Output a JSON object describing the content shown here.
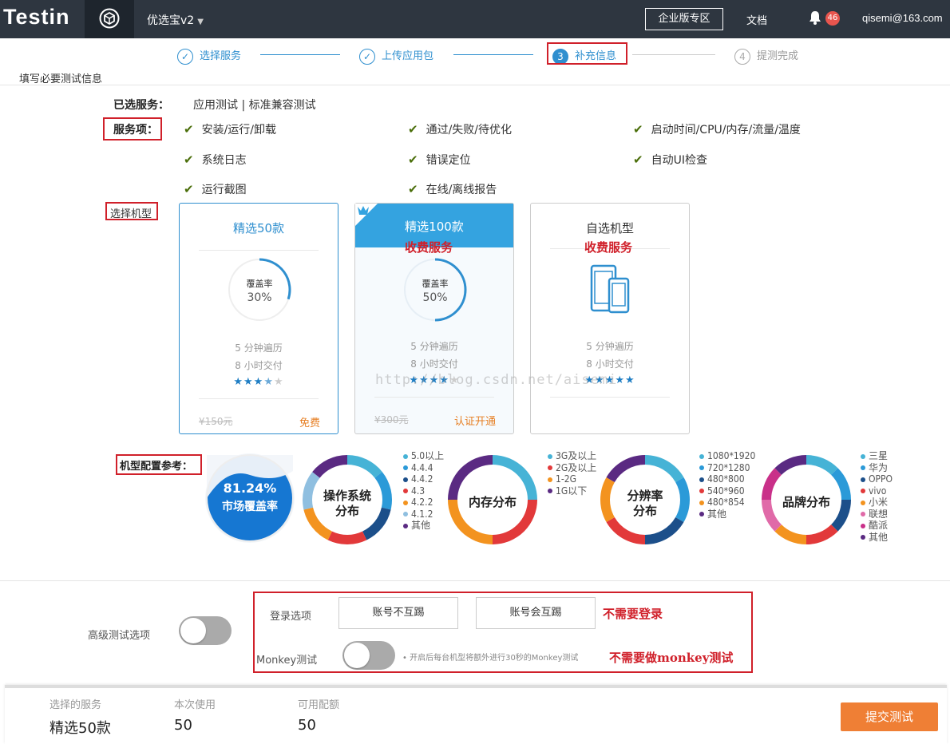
{
  "topbar": {
    "logo": "Testin",
    "product": "优选宝v2",
    "enterprise_button": "企业版专区",
    "docs": "文档",
    "notification_count": "46",
    "user": "qisemi@163.com"
  },
  "steps": [
    {
      "num": "✓",
      "label": "选择服务"
    },
    {
      "num": "✓",
      "label": "上传应用包"
    },
    {
      "num": "3",
      "label": "补充信息"
    },
    {
      "num": "4",
      "label": "提测完成"
    }
  ],
  "section_title": "填写必要测试信息",
  "selected_services": {
    "label": "已选服务：",
    "value": "应用测试 | 标准兼容测试"
  },
  "service_items": {
    "label": "服务项：",
    "items": [
      "安装/运行/卸载",
      "通过/失败/待优化",
      "启动时间/CPU/内存/流量/温度",
      "系统日志",
      "错误定位",
      "自动UI检查",
      "运行截图",
      "在线/离线报告"
    ]
  },
  "model_select": {
    "label": "选择机型",
    "cards": [
      {
        "title": "精选50款",
        "coverage_label": "覆盖率",
        "coverage": "30%",
        "coverage_value": 0.3,
        "line1": "5 分钟遍历",
        "line2": "8 小时交付",
        "stars": "★★★★★",
        "rating": 3.5,
        "old_price": "¥150元",
        "price": "免费"
      },
      {
        "title": "精选100款",
        "annotation": "收费服务",
        "coverage_label": "覆盖率",
        "coverage": "50%",
        "coverage_value": 0.5,
        "line1": "5 分钟遍历",
        "line2": "8 小时交付",
        "stars": "★★★★★",
        "rating": 4,
        "old_price": "¥300元",
        "price": "认证开通"
      },
      {
        "title": "自选机型",
        "annotation": "收费服务",
        "line1": "5 分钟遍历",
        "line2": "8 小时交付",
        "stars": "★★★★★",
        "rating": 5
      }
    ]
  },
  "watermark": "http://blog.csdn.net/aisemi",
  "config_ref": {
    "label": "机型配置参考：",
    "market": {
      "percent": "81.24%",
      "label": "市场覆盖率"
    },
    "charts": [
      {
        "title1": "操作系统",
        "title2": "分布",
        "legend": [
          "5.0以上",
          "4.4.4",
          "4.4.2",
          "4.3",
          "4.2.2",
          "4.1.2",
          "其他"
        ]
      },
      {
        "title1": "内存分布",
        "title2": "",
        "legend": [
          "3G及以上",
          "2G及以上",
          "1-2G",
          "1G以下"
        ]
      },
      {
        "title1": "分辨率",
        "title2": "分布",
        "legend": [
          "1080*1920",
          "720*1280",
          "480*800",
          "540*960",
          "480*854",
          "其他"
        ]
      },
      {
        "title1": "品牌分布",
        "title2": "",
        "legend": [
          "三星",
          "华为",
          "OPPO",
          "vivo",
          "小米",
          "联想",
          "酷派",
          "其他"
        ]
      }
    ]
  },
  "advanced": {
    "label": "高级测试选项",
    "login_label": "登录选项",
    "login_option_1": "账号不互踢",
    "login_option_2": "账号会互踢",
    "login_note": "不需要登录",
    "monkey_label": "Monkey测试",
    "monkey_hint": "• 开启后每台机型将额外进行30秒的Monkey测试",
    "monkey_note": "不需要做monkey测试"
  },
  "footer": {
    "selected_label": "选择的服务",
    "selected_value": "精选50款",
    "use_label": "本次使用",
    "use_value": "50",
    "avail_label": "可用配额",
    "avail_value": "50",
    "submit": "提交测试"
  },
  "colors": {
    "accent": "#2f8fcf",
    "topbar": "#2e3640",
    "submit": "#ef7f35",
    "annotation": "#d0202a"
  }
}
